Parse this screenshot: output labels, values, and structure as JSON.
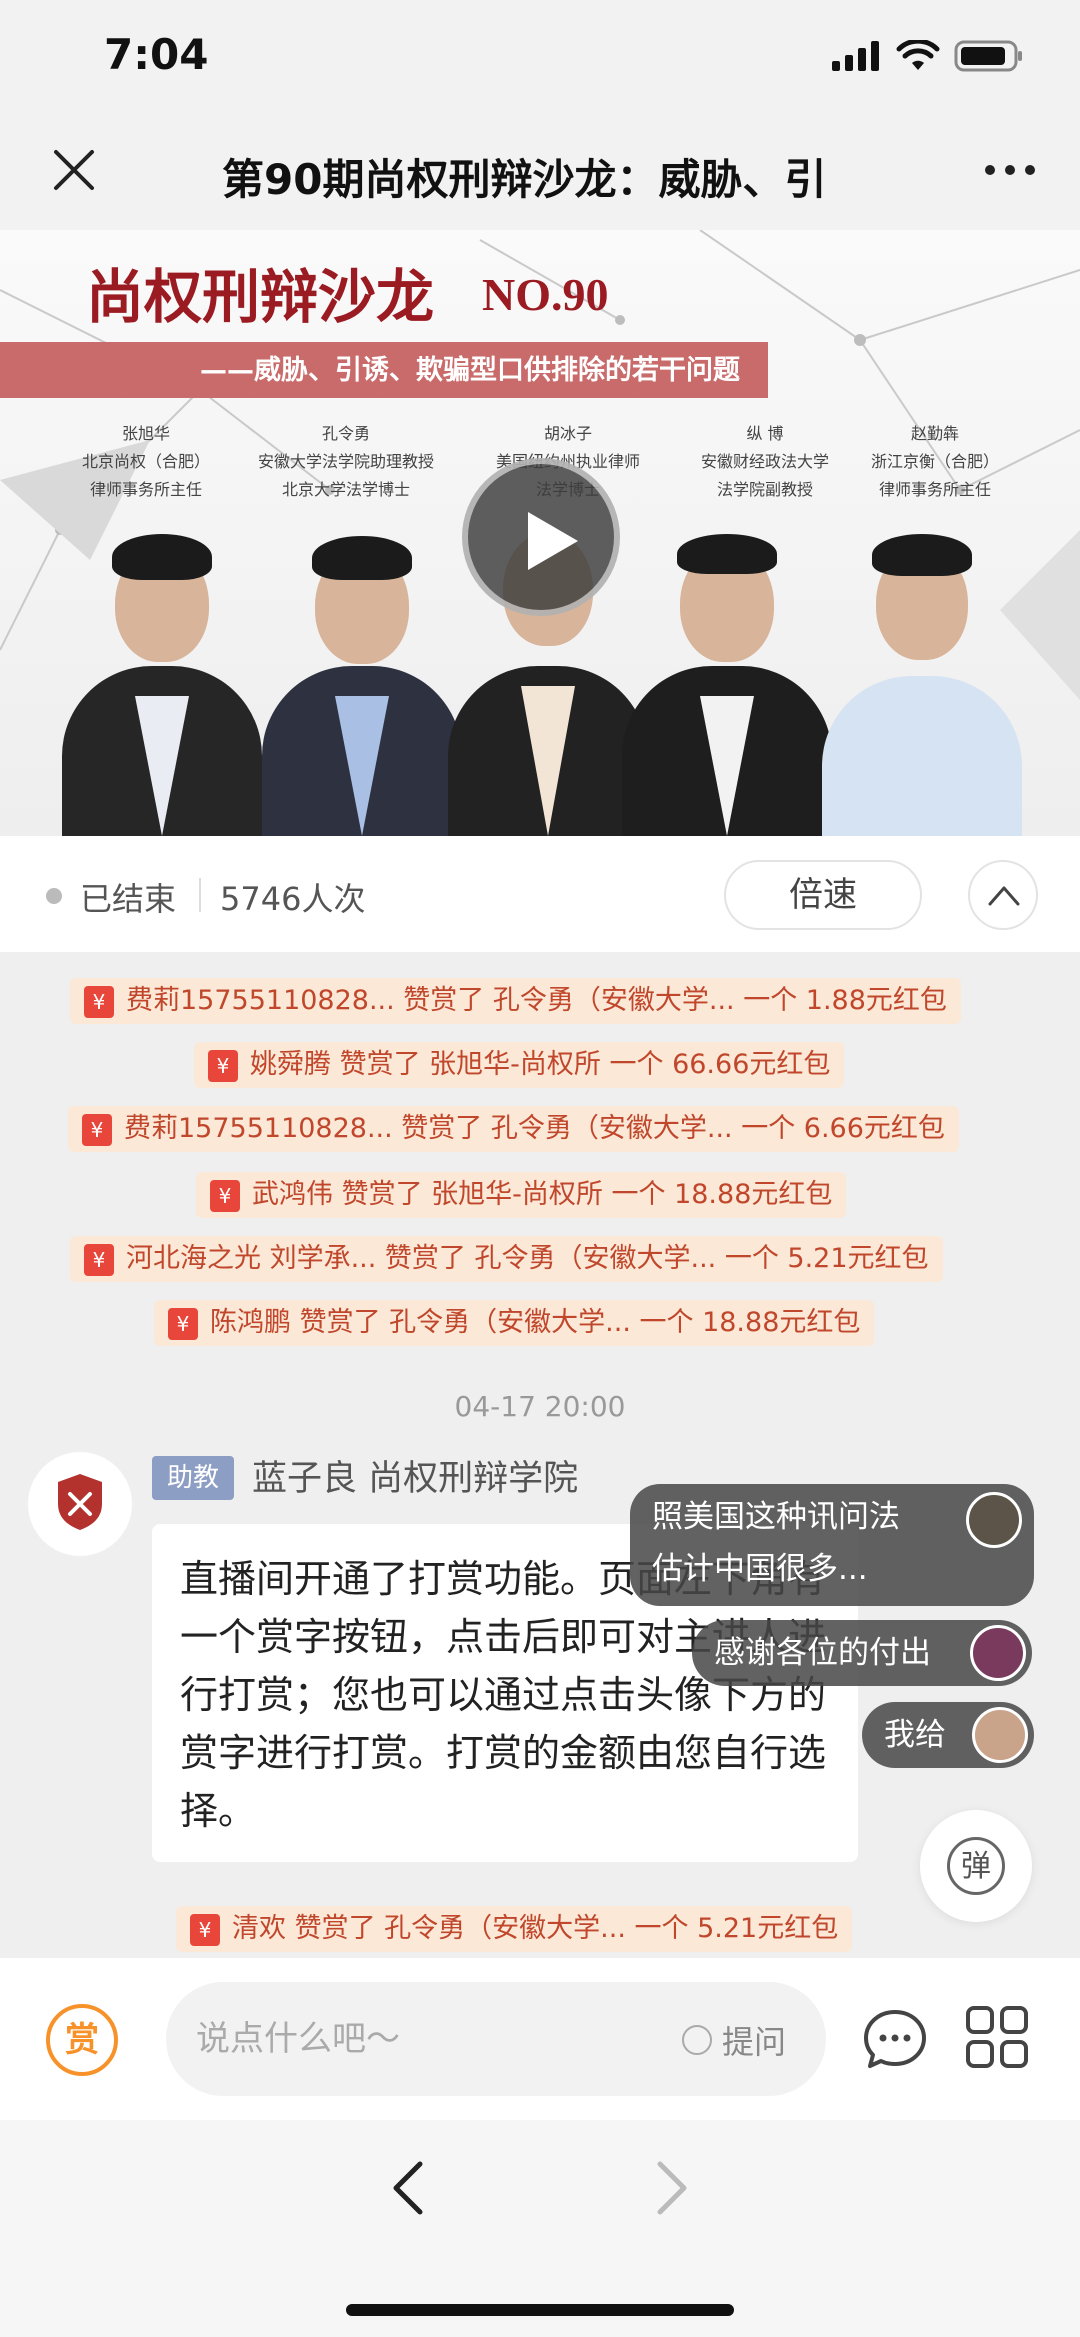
{
  "status_bar": {
    "time": "7:04"
  },
  "nav": {
    "title": "第90期尚权刑辩沙龙：威胁、引"
  },
  "banner": {
    "title": "尚权刑辩沙龙",
    "issue": "NO.90",
    "subtitle": "——威胁、引诱、欺骗型口供排除的若干问题",
    "speakers": [
      {
        "name": "张旭华",
        "line1": "北京尚权（合肥）",
        "line2": "律师事务所主任"
      },
      {
        "name": "孔令勇",
        "line1": "安徽大学法学院助理教授",
        "line2": "北京大学法学博士"
      },
      {
        "name": "胡冰子",
        "line1": "美国纽约州执业律师",
        "line2": "法学博士"
      },
      {
        "name": "纵 博",
        "line1": "安徽财经政法大学",
        "line2": "法学院副教授"
      },
      {
        "name": "赵勤犇",
        "line1": "浙江京衡（合肥）",
        "line2": "律师事务所主任"
      }
    ]
  },
  "info": {
    "status": "已结束",
    "viewers": "5746人次",
    "speed_label": "倍速"
  },
  "reward_icon_char": "¥",
  "rewards": [
    {
      "text": "费莉15755110828...  赞赏了  孔令勇（安徽大学...  一个 1.88元红包"
    },
    {
      "text": "姚舜腾 赞赏了 张旭华-尚权所 一个 66.66元红包"
    },
    {
      "text": "费莉15755110828...  赞赏了  孔令勇（安徽大学...  一个 6.66元红包"
    },
    {
      "text": "武鸿伟 赞赏了 张旭华-尚权所 一个 18.88元红包"
    },
    {
      "text": "河北海之光 刘学承...  赞赏了  孔令勇（安徽大学...  一个 5.21元红包"
    },
    {
      "text": "陈鸿鹏 赞赏了  孔令勇（安徽大学...  一个 18.88元红包"
    },
    {
      "text": "清欢 赞赏了  孔令勇（安徽大学...  一个 5.21元红包"
    }
  ],
  "chat": {
    "timestamp": "04-17 20:00",
    "role": "助教",
    "sender": "蓝子良 尚权刑辩学院",
    "message": "直播间开通了打赏功能。页面左下角有一个赏字按钮，点击后即可对主讲人进行打赏；您也可以通过点击头像下方的赏字进行打赏。打赏的金额由您自行选择。"
  },
  "danmaku": [
    {
      "line1": "照美国这种讯问法",
      "line2": "估计中国很多..."
    },
    {
      "line1": "感谢各位的付出"
    },
    {
      "line1": "我给"
    }
  ],
  "danmu_toggle": "弹",
  "input": {
    "reward_label": "赏",
    "placeholder": "说点什么吧～",
    "ask_label": "提问"
  },
  "colors": {
    "accent": "#f7922b",
    "reward_bg": "#fbe8d6",
    "reward_text": "#c0472c",
    "brand": "#9b1b22"
  }
}
